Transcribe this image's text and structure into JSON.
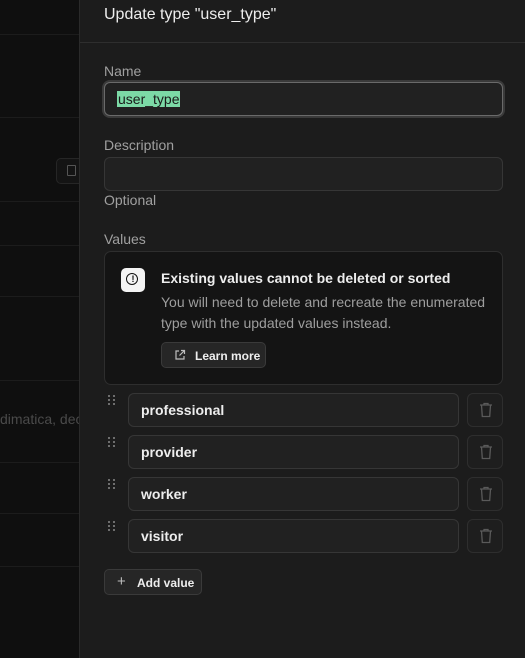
{
  "background": {
    "fragment_text": "dimatica, dec"
  },
  "panel": {
    "title": "Update type \"user_type\"",
    "name_label": "Name",
    "name_value": "user_type",
    "description_label": "Description",
    "description_value": "",
    "description_hint": "Optional",
    "values_label": "Values"
  },
  "callout": {
    "title": "Existing values cannot be deleted or sorted",
    "body": "You will need to delete and recreate the enumerated type with the updated values instead.",
    "learn_more_label": "Learn more"
  },
  "values": [
    {
      "label": "professional"
    },
    {
      "label": "provider"
    },
    {
      "label": "worker"
    },
    {
      "label": "visitor"
    }
  ],
  "add_value_label": "Add value",
  "colors": {
    "panel_bg": "#1c1c1c",
    "selection_highlight": "#7cd9a6",
    "field_bg": "#212121"
  }
}
